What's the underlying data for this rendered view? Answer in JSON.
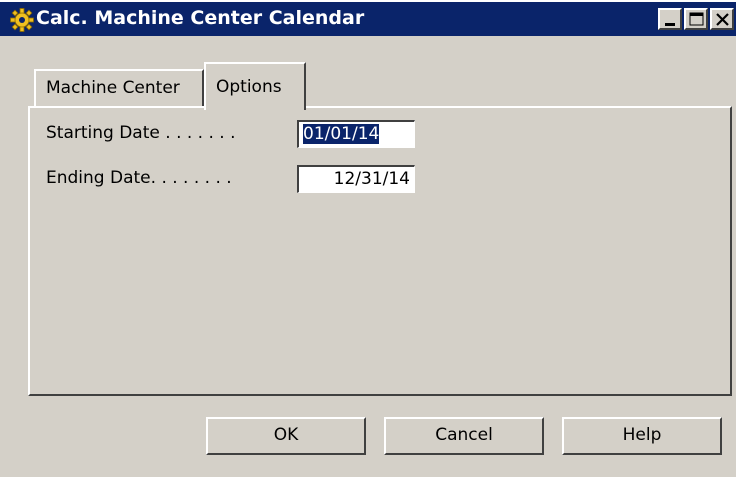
{
  "window": {
    "title": "Calc. Machine Center Calendar",
    "icon": "gear-icon",
    "controls": {
      "minimize": "minimize-icon",
      "maximize": "maximize-icon",
      "close": "close-icon"
    }
  },
  "tabs": [
    {
      "label": "Machine Center",
      "active": false
    },
    {
      "label": "Options",
      "active": true
    }
  ],
  "options": {
    "starting_date": {
      "label": "Starting Date . . . . . . .",
      "value": "01/01/14",
      "selected": true
    },
    "ending_date": {
      "label": "Ending Date. . . . . . . .",
      "value": "12/31/14"
    }
  },
  "buttons": {
    "ok": "OK",
    "cancel": "Cancel",
    "help": "Help"
  },
  "colors": {
    "titlebar": "#0a246a",
    "face": "#d4d0c8",
    "selection": "#0a246a"
  }
}
